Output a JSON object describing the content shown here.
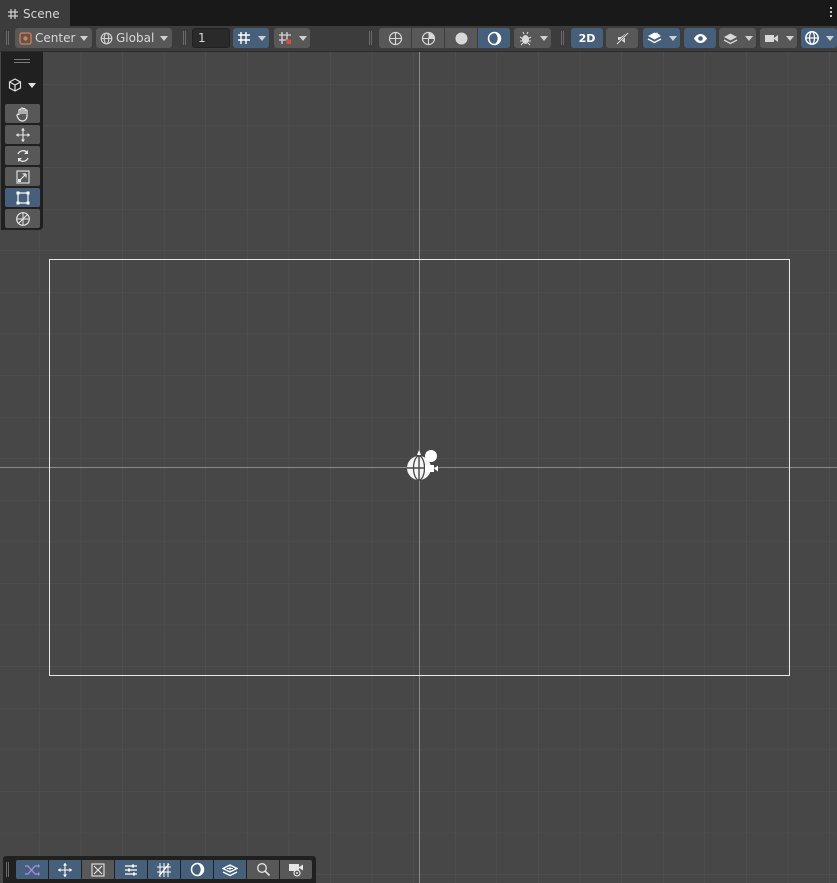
{
  "tab": {
    "icon": "grid-icon",
    "label": "Scene"
  },
  "toolbar": {
    "pivot_mode": "Center",
    "pivot_rotation": "Global",
    "grid_size_value": "1",
    "mode_2d_label": "2D",
    "accent_color": "#46607c",
    "button_color": "#585858"
  },
  "tools_overlay": {
    "view_tool": "cube-view-icon",
    "items": [
      {
        "name": "hand-tool",
        "icon": "hand-icon",
        "active": false
      },
      {
        "name": "move-tool",
        "icon": "move-arrows-icon",
        "active": false
      },
      {
        "name": "rotate-tool",
        "icon": "rotate-icon",
        "active": false
      },
      {
        "name": "scale-tool",
        "icon": "scale-icon",
        "active": false
      },
      {
        "name": "rect-tool",
        "icon": "rect-transform-icon",
        "active": true
      },
      {
        "name": "transform-tool",
        "icon": "transform-icon",
        "active": false
      }
    ]
  },
  "bottom_overlay": {
    "items": [
      {
        "name": "shuffle-button",
        "icon": "shuffle-icon",
        "active": true
      },
      {
        "name": "move-overlay-button",
        "icon": "move-arrows-icon",
        "active": true
      },
      {
        "name": "snap-scale-button",
        "icon": "snap-scale-icon",
        "active": false
      },
      {
        "name": "sliders-button",
        "icon": "sliders-icon",
        "active": true
      },
      {
        "name": "grid-snap-button",
        "icon": "grid-snap-icon",
        "active": true
      },
      {
        "name": "lighting-button",
        "icon": "moon-icon",
        "active": true
      },
      {
        "name": "layers-button",
        "icon": "layers-icon",
        "active": true
      },
      {
        "name": "search-button",
        "icon": "search-icon",
        "active": false
      },
      {
        "name": "camera-button",
        "icon": "camera-icon",
        "active": false
      }
    ]
  }
}
